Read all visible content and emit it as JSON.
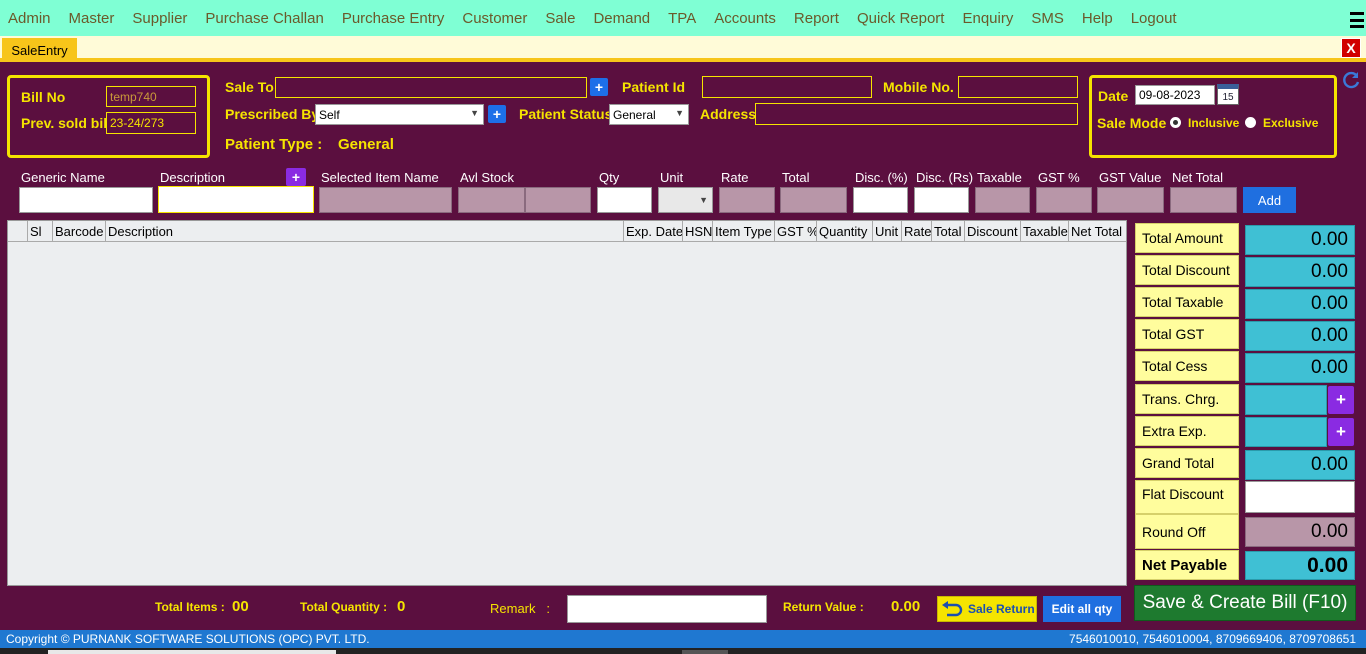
{
  "menu": [
    "Admin",
    "Master",
    "Supplier",
    "Purchase Challan",
    "Purchase Entry",
    "Customer",
    "Sale",
    "Demand",
    "TPA",
    "Accounts",
    "Report",
    "Quick Report",
    "Enquiry",
    "SMS",
    "Help",
    "Logout"
  ],
  "tab": {
    "label": "SaleEntry",
    "close": "X"
  },
  "bill": {
    "bill_no_label": "Bill No",
    "bill_no_value": "temp740",
    "prev_sold_label": "Prev. sold bill",
    "prev_sold_value": "23-24/273"
  },
  "patient": {
    "sale_to_label": "Sale To",
    "sale_to_value": "",
    "patient_id_label": "Patient Id",
    "patient_id_value": "",
    "mobile_label": "Mobile No.",
    "mobile_value": "",
    "prescribed_by_label": "Prescribed By",
    "prescribed_by_value": "Self",
    "patient_status_label": "Patient Status",
    "patient_status_value": "General",
    "address_label": "Address",
    "address_value": "",
    "patient_type_label": "Patient Type :",
    "patient_type_value": "General",
    "plus": "+"
  },
  "date_box": {
    "date_label": "Date",
    "date_value": "09-08-2023",
    "calendar_day": "15",
    "sale_mode_label": "Sale Mode",
    "inclusive": "Inclusive",
    "exclusive": "Exclusive",
    "selected_mode": "Inclusive"
  },
  "item_entry": {
    "generic_name": "Generic Name",
    "description": "Description",
    "selected_item_name": "Selected Item Name",
    "avl_stock": "Avl Stock",
    "qty": "Qty",
    "unit": "Unit",
    "rate": "Rate",
    "total": "Total",
    "disc_pct": "Disc. (%)",
    "disc_rs": "Disc. (Rs)",
    "taxable": "Taxable",
    "gst_pct": "GST %",
    "gst_value": "GST Value",
    "net_total": "Net Total",
    "add_button": "Add",
    "plus": "+"
  },
  "grid": {
    "columns": [
      "Sl",
      "Barcode",
      "Description",
      "Exp. Date",
      "HSN",
      "Item Type",
      "GST %",
      "Quantity",
      "Unit",
      "Rate",
      "Total",
      "Discount",
      "Taxable",
      "Net Total"
    ],
    "rows": []
  },
  "summary": {
    "total_amount_label": "Total Amount",
    "total_amount": "0.00",
    "total_discount_label": "Total Discount",
    "total_discount": "0.00",
    "total_taxable_label": "Total Taxable",
    "total_taxable": "0.00",
    "total_gst_label": "Total GST",
    "total_gst": "0.00",
    "total_cess_label": "Total Cess",
    "total_cess": "0.00",
    "trans_chrg_label": "Trans. Chrg.",
    "trans_chrg": "",
    "extra_exp_label": "Extra Exp.",
    "extra_exp": "",
    "grand_total_label": "Grand Total",
    "grand_total": "0.00",
    "flat_discount_label": "Flat Discount",
    "flat_discount": "",
    "round_off_label": "Round Off",
    "round_off": "0.00",
    "net_payable_label": "Net Payable",
    "net_payable": "0.00",
    "plus": "+"
  },
  "bottom": {
    "total_items_label": "Total Items :",
    "total_items": "00",
    "total_quantity_label": "Total Quantity :",
    "total_quantity": "0",
    "remark_label": "Remark   :",
    "remark_value": "",
    "return_value_label": "Return Value :",
    "return_value": "0.00",
    "sale_return_button": "Sale Return",
    "edit_all_qty_button": "Edit all qty",
    "save_button": "Save & Create Bill (F10)"
  },
  "footer": {
    "copyright": "Copyright © PURNANK SOFTWARE SOLUTIONS (OPC) PVT. LTD.",
    "phones": "7546010010, 7546010004, 8709669406, 8709708651"
  },
  "colors": {
    "background": "#5b0f3f",
    "menubar": "#7fffd4",
    "accent_yellow": "#f5e400",
    "summary_value": "#3fc0d4",
    "save_button": "#1e7a2f",
    "footer": "#1f78d1"
  }
}
